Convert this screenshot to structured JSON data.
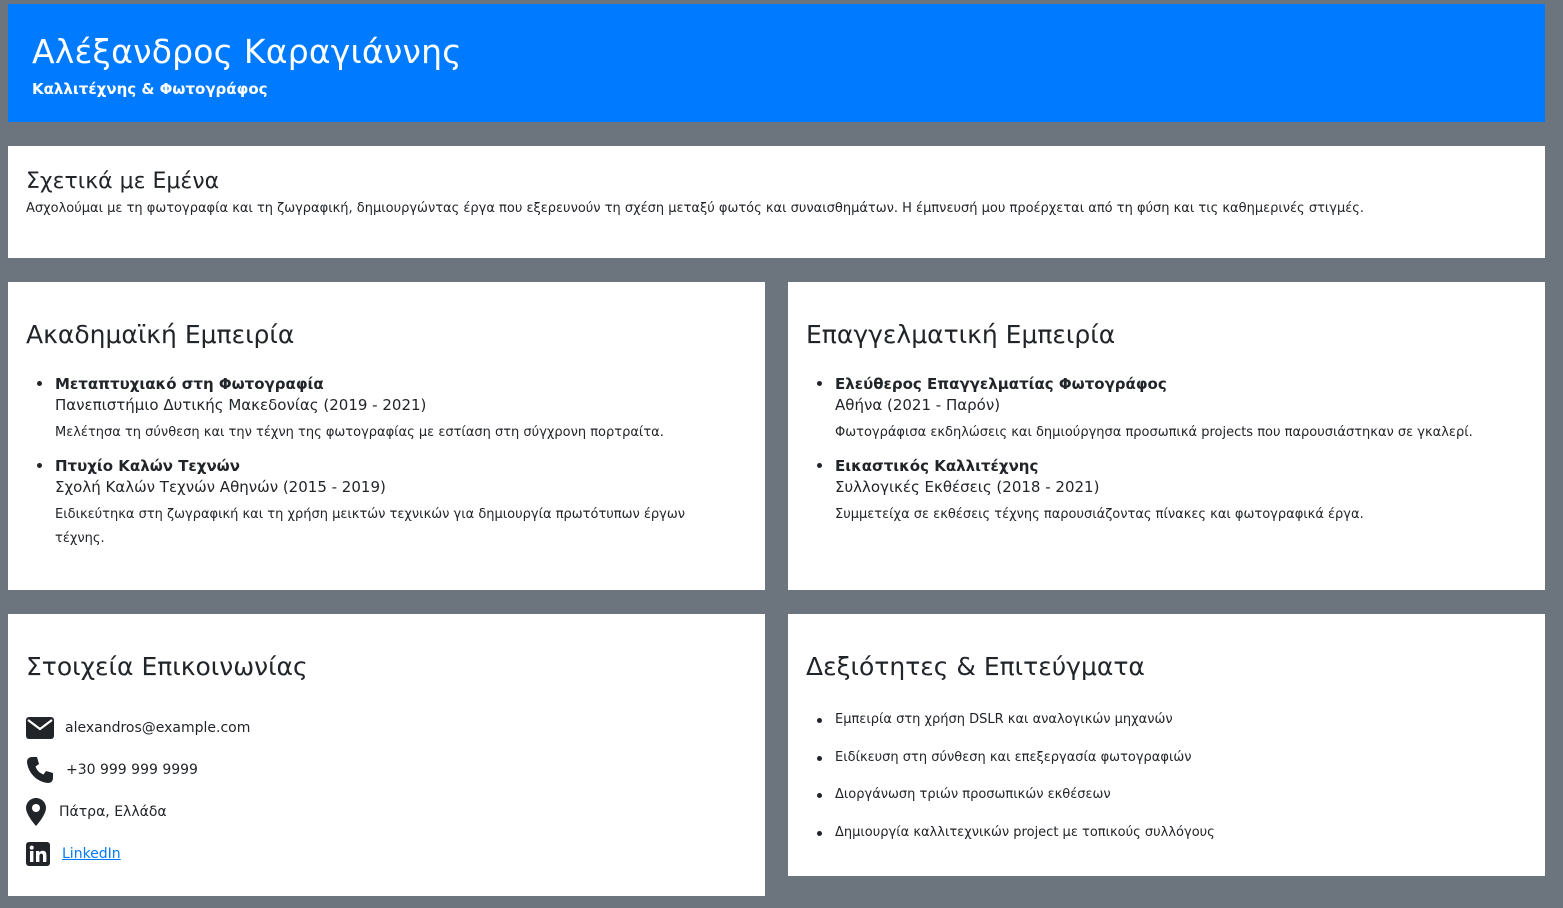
{
  "header": {
    "name": "Αλέξανδρος Καραγιάννης",
    "subtitle": "Καλλιτέχνης & Φωτογράφος"
  },
  "about": {
    "title": "Σχετικά με Εμένα",
    "text": "Ασχολούμαι με τη φωτογραφία και τη ζωγραφική, δημιουργώντας έργα που εξερευνούν τη σχέση μεταξύ φωτός και συναισθημάτων. Η έμπνευσή μου προέρχεται από τη φύση και τις καθημερινές στιγμές."
  },
  "academic": {
    "title": "Ακαδημαϊκή Εμπειρία",
    "items": [
      {
        "role": "Μεταπτυχιακό στη Φωτογραφία",
        "place": "Πανεπιστήμιο Δυτικής Μακεδονίας (2019 - 2021)",
        "desc": "Μελέτησα τη σύνθεση και την τέχνη της φωτογραφίας με εστίαση στη σύγχρονη πορτραίτα."
      },
      {
        "role": "Πτυχίο Καλών Τεχνών",
        "place": "Σχολή Καλών Τεχνών Αθηνών (2015 - 2019)",
        "desc": "Ειδικεύτηκα στη ζωγραφική και τη χρήση μεικτών τεχνικών για δημιουργία πρωτότυπων έργων τέχνης."
      }
    ]
  },
  "professional": {
    "title": "Επαγγελματική Εμπειρία",
    "items": [
      {
        "role": "Ελεύθερος Επαγγελματίας Φωτογράφος",
        "place": "Αθήνα (2021 - Παρόν)",
        "desc": "Φωτογράφισα εκδηλώσεις και δημιούργησα προσωπικά projects που παρουσιάστηκαν σε γκαλερί."
      },
      {
        "role": "Εικαστικός Καλλιτέχνης",
        "place": "Συλλογικές Εκθέσεις (2018 - 2021)",
        "desc": "Συμμετείχα σε εκθέσεις τέχνης παρουσιάζοντας πίνακες και φωτογραφικά έργα."
      }
    ]
  },
  "contact": {
    "title": "Στοιχεία Επικοινωνίας",
    "email": "alexandros@example.com",
    "phone": "+30 999 999 9999",
    "location": "Πάτρα, Ελλάδα",
    "linkedin": "LinkedIn",
    "icons": [
      "envelope-icon",
      "phone-icon",
      "map-marker-icon",
      "linkedin-icon"
    ]
  },
  "skills": {
    "title": "Δεξιότητες & Επιτεύγματα",
    "items": [
      "Εμπειρία στη χρήση DSLR και αναλογικών μηχανών",
      "Ειδίκευση στη σύνθεση και επεξεργασία φωτογραφιών",
      "Διοργάνωση τριών προσωπικών εκθέσεων",
      "Δημιουργία καλλιτεχνικών project με τοπικούς συλλόγους"
    ]
  },
  "colors": {
    "header_bg": "#007bff",
    "page_bg": "#6c757d",
    "link": "#007bff",
    "text": "#212529"
  }
}
